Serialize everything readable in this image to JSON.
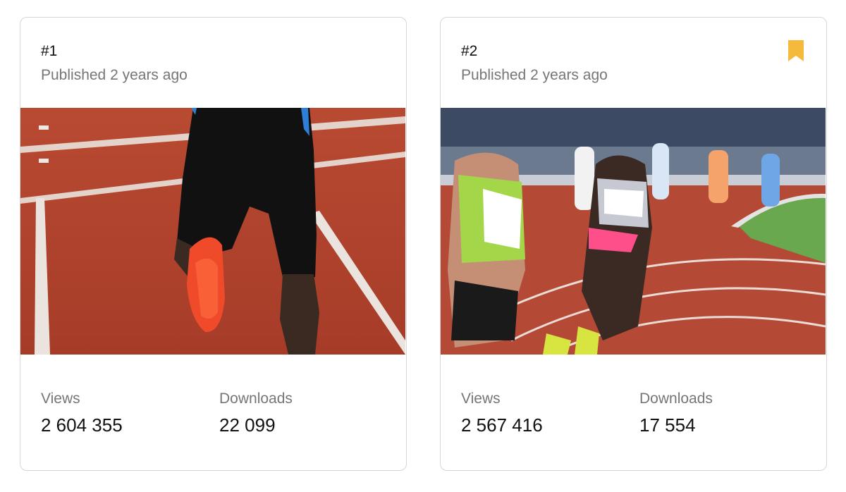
{
  "cards": [
    {
      "rank": "#1",
      "published": "Published 2 years ago",
      "bookmarked": false,
      "image": "sprinter-legs-on-red-track",
      "stats": {
        "views_label": "Views",
        "views_value": "2 604 355",
        "downloads_label": "Downloads",
        "downloads_value": "22 099"
      }
    },
    {
      "rank": "#2",
      "published": "Published 2 years ago",
      "bookmarked": true,
      "bookmark_icon": "bookmark-icon",
      "bookmark_color": "#f5b93b",
      "image": "women-runners-race-on-track",
      "stats": {
        "views_label": "Views",
        "views_value": "2 567 416",
        "downloads_label": "Downloads",
        "downloads_value": "17 554"
      }
    }
  ]
}
